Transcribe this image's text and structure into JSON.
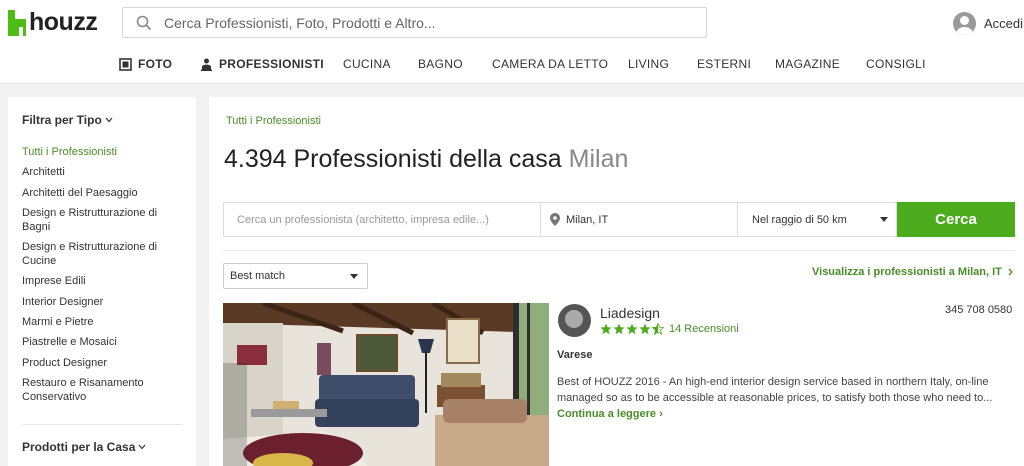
{
  "header": {
    "logo_text": "houzz",
    "search_placeholder": "Cerca Professionisti, Foto, Prodotti e Altro...",
    "login_label": "Accedi"
  },
  "nav": {
    "foto": "FOTO",
    "professionisti": "PROFESSIONISTI",
    "cucina": "CUCINA",
    "bagno": "BAGNO",
    "camera": "CAMERA DA LETTO",
    "living": "LIVING",
    "esterni": "ESTERNI",
    "magazine": "MAGAZINE",
    "consigli": "CONSIGLI"
  },
  "sidebar": {
    "filter_title": "Filtra per Tipo",
    "categories": [
      "Tutti i Professionisti",
      "Architetti",
      "Architetti del Paesaggio",
      "Design e Ristrutturazione di Bagni",
      "Design e Ristrutturazione di Cucine",
      "Imprese Edili",
      "Interior Designer",
      "Marmi e Pietre",
      "Piastrelle e Mosaici",
      "Product Designer",
      "Restauro e Risanamento Conservativo"
    ],
    "products_title": "Prodotti per la Casa"
  },
  "main": {
    "breadcrumb": "Tutti i Professionisti",
    "heading_prefix": "4.394 Professionisti della casa",
    "heading_location": "Milan",
    "search_placeholder": "Cerca un professionista (architetto, impresa edile...)",
    "location_value": "Milan, IT",
    "radius_value": "Nel raggio di 50 km",
    "search_button": "Cerca",
    "sort_value": "Best match",
    "view_map_link": "Visualizza i professionisti a Milan, IT"
  },
  "listing": {
    "name": "Liadesign",
    "rating": 4.5,
    "reviews": "14 Recensioni",
    "phone": "345 708 0580",
    "city": "Varese",
    "description": "Best of HOUZZ 2016 - An high-end interior design service based in northern Italy, on-line managed so as to be accessible at reasonable prices, to satisfy both those who need to...",
    "read_more": "Continua a leggere"
  },
  "colors": {
    "brand_green": "#4dbc15",
    "link_green": "#4a8d2b",
    "button_green": "#4dac1e"
  }
}
